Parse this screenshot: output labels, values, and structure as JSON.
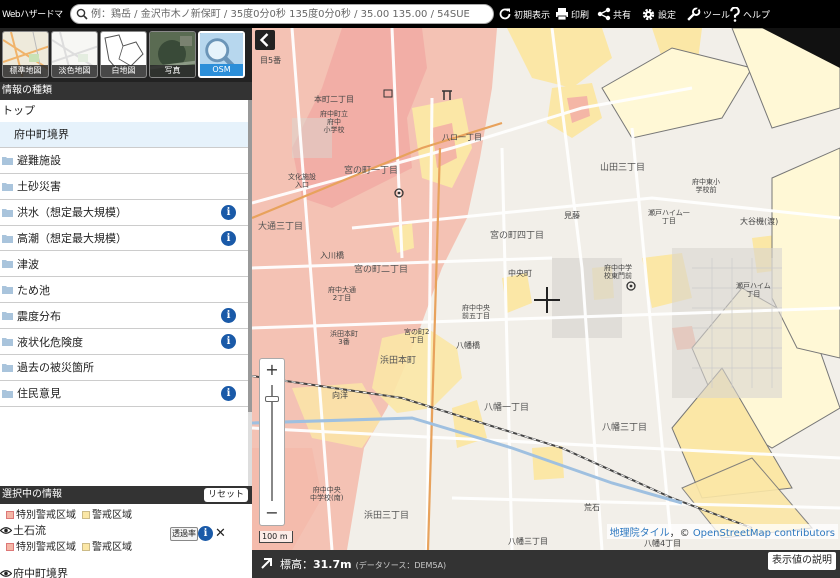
{
  "header": {
    "app_title": "Webハザードマップ",
    "search_placeholder": "例：鶏岳 / 金沢市木ノ新保町 / 35度0分0秒 135度0分0秒 / 35.00 135.00 / 54SUE",
    "tools": {
      "init_view": "初期表示",
      "print": "印刷",
      "share": "共有",
      "settings": "設定",
      "tools": "ツール",
      "help": "ヘルプ"
    }
  },
  "basemaps": [
    {
      "label": "標準地図",
      "active": false
    },
    {
      "label": "淡色地図",
      "active": false
    },
    {
      "label": "白地図",
      "active": false
    },
    {
      "label": "写真",
      "active": false
    },
    {
      "label": "OSM",
      "active": true
    }
  ],
  "info_panel": {
    "title": "情報の種類",
    "top_label": "トップ",
    "layers": [
      {
        "label": "府中町境界",
        "folder": false,
        "info": false
      },
      {
        "label": "避難施設",
        "folder": true,
        "info": false
      },
      {
        "label": "土砂災害",
        "folder": true,
        "info": false
      },
      {
        "label": "洪水（想定最大規模）",
        "folder": true,
        "info": true
      },
      {
        "label": "高潮（想定最大規模）",
        "folder": true,
        "info": true
      },
      {
        "label": "津波",
        "folder": true,
        "info": false
      },
      {
        "label": "ため池",
        "folder": true,
        "info": false
      },
      {
        "label": "震度分布",
        "folder": true,
        "info": true
      },
      {
        "label": "液状化危険度",
        "folder": true,
        "info": true
      },
      {
        "label": "過去の被災箇所",
        "folder": true,
        "info": false
      },
      {
        "label": "住民意見",
        "folder": true,
        "info": true
      }
    ]
  },
  "selected_panel": {
    "title": "選択中の情報",
    "reset_label": "リセット",
    "row0": {
      "legend_a": "特別警戒区域",
      "legend_b": "警戒区域"
    },
    "item1": {
      "title": "土石流",
      "opacity_label": "透過率",
      "legend_a": "特別警戒区域",
      "legend_b": "警戒区域"
    },
    "item2": {
      "title": "府中町境界"
    }
  },
  "map": {
    "labels": {
      "l_5ban": "目5番",
      "honmachi2": "本町二丁目",
      "elem_school": "府中町立\n府中\n小学校",
      "bunka": "文化施設\n入口",
      "miya1": "宮の町一丁目",
      "hira1": "八ロ一丁目",
      "yamada3": "山田三丁目",
      "ohdori3": "大通三丁目",
      "irikawa": "入川橋",
      "miya2": "宮の町二丁目",
      "miya4": "宮の町四丁目",
      "fuchu_ohdori2": "府中大通\n2丁目",
      "hamada_hon3": "浜田本町\n3番",
      "miya_no_machi2": "宮の町2\n丁目",
      "hamada_honmachi": "浜田本町",
      "yawata": "八幡橋",
      "hachiman1": "八幡一丁目",
      "hachiman3": "八幡三丁目",
      "mukainada": "向洋",
      "fuchu_chu": "府中中央\n中学校(南)",
      "hamada3": "浜田三丁目",
      "setomachi": "瀬戸ハイム一\n丁目",
      "setomachi_b": "瀬戸ハイム\n丁目",
      "ogi": "大谷機(渡)",
      "fuchu_higashi": "府中東小\n学校前",
      "fuchu_junior": "府中中学\n校東門前",
      "hachiman4": "八幡4丁目",
      "hachiman_shin": "八幡三丁目",
      "ishi": "荒石",
      "fuchu_bus": "府中中央\n前五丁目",
      "l_mido": "見藤",
      "nakano": "中央町"
    },
    "zoom_in_label": "+",
    "zoom_out_label": "−",
    "scale_label": "100 m",
    "attribution_gsi": "地理院タイル",
    "attribution_sep": "，©",
    "attribution_osm": "OpenStreetMap contributors",
    "zoom_level_fraction": 0.12
  },
  "status_bar": {
    "elevation_label": "標高：",
    "elevation_value": "31.7m",
    "data_source": "(データソース：DEM5A)",
    "legend_button": "表示値の説明"
  },
  "colors": {
    "flood_pink": "#f4b6a6",
    "landslide_yellow": "#fbe7a6",
    "info_blue": "#1a5aa8",
    "active_tab": "#2c8fd9"
  }
}
